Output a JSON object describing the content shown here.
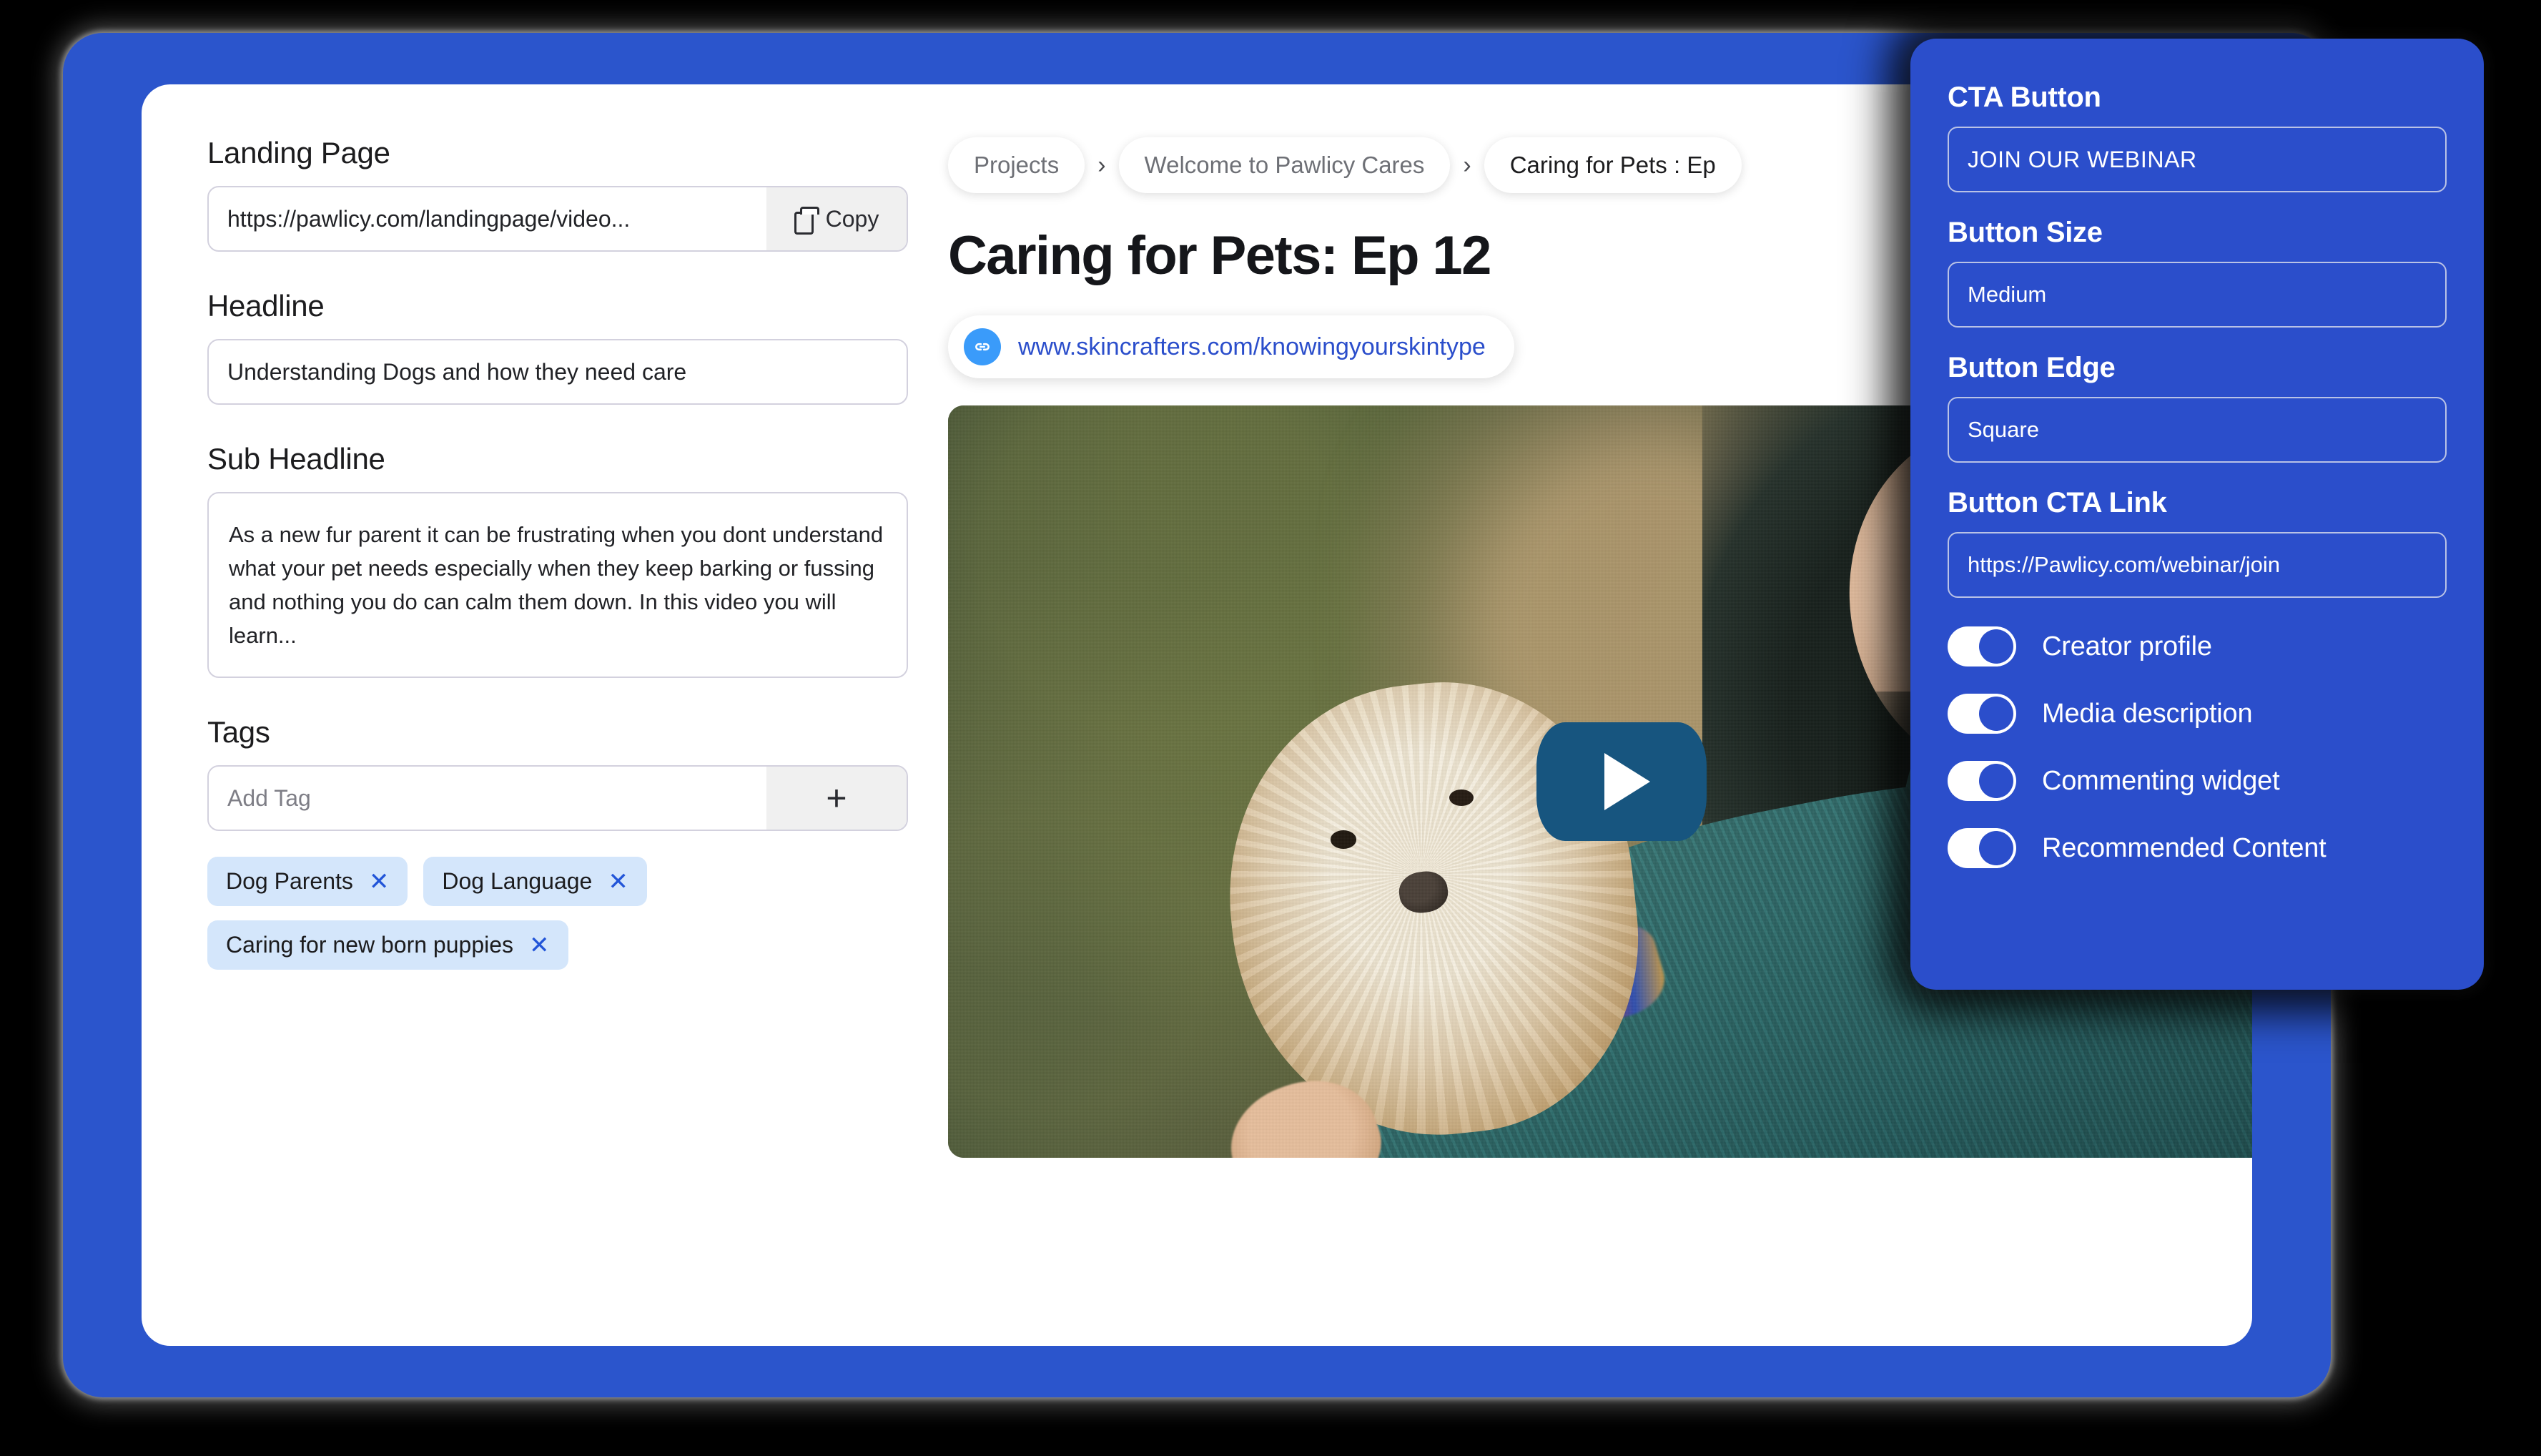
{
  "colors": {
    "frame_blue": "#2B55CC",
    "panel_blue": "#2B4ECB",
    "tag_chip_bg": "#D4E6FB",
    "tag_x": "#2255D8",
    "link_badge": "#3A9BFA",
    "link_text": "#2B4ECB",
    "play_button": "#17557F",
    "input_border": "#D3D1DE",
    "addon_bg": "#F0F0F0"
  },
  "left_form": {
    "landing_page": {
      "label": "Landing Page",
      "value": "https://pawlicy.com/landingpage/video...",
      "copy_label": "Copy",
      "copy_icon": "copy-icon"
    },
    "headline": {
      "label": "Headline",
      "value": "Understanding Dogs and how they need care"
    },
    "sub_headline": {
      "label": "Sub Headline",
      "value": "As a new fur parent it can be frustrating when you dont understand what your pet needs especially when they keep barking or fussing and nothing you do can calm them down. In this video you will learn..."
    },
    "tags": {
      "label": "Tags",
      "input_placeholder": "Add Tag",
      "add_icon": "plus-icon",
      "add_symbol": "+",
      "chips": [
        {
          "label": "Dog Parents",
          "remove": "✕"
        },
        {
          "label": "Dog Language",
          "remove": "✕"
        },
        {
          "label": "Caring for new born puppies",
          "remove": "✕"
        }
      ]
    }
  },
  "content": {
    "breadcrumb": {
      "items": [
        {
          "label": "Projects",
          "current": false
        },
        {
          "label": "Welcome to Pawlicy Cares",
          "current": false
        },
        {
          "label": "Caring for Pets : Ep",
          "current": true
        }
      ],
      "separator": "›"
    },
    "title": "Caring for Pets: Ep 12",
    "link": {
      "icon": "link-icon",
      "url": "www.skincrafters.com/knowingyourskintype"
    },
    "video": {
      "play_icon": "play-icon",
      "alt": "Woman with glasses holding a small fluffy dog wrapped in a teal knit sweater"
    }
  },
  "settings_panel": {
    "cta_button": {
      "label": "CTA Button",
      "value": "JOIN OUR WEBINAR"
    },
    "button_size": {
      "label": "Button Size",
      "value": "Medium"
    },
    "button_edge": {
      "label": "Button Edge",
      "value": "Square"
    },
    "button_cta_link": {
      "label": "Button CTA Link",
      "value": "https://Pawlicy.com/webinar/join"
    },
    "toggles": [
      {
        "label": "Creator profile",
        "on": true
      },
      {
        "label": "Media description",
        "on": true
      },
      {
        "label": "Commenting widget",
        "on": true
      },
      {
        "label": "Recommended Content",
        "on": true
      }
    ]
  }
}
